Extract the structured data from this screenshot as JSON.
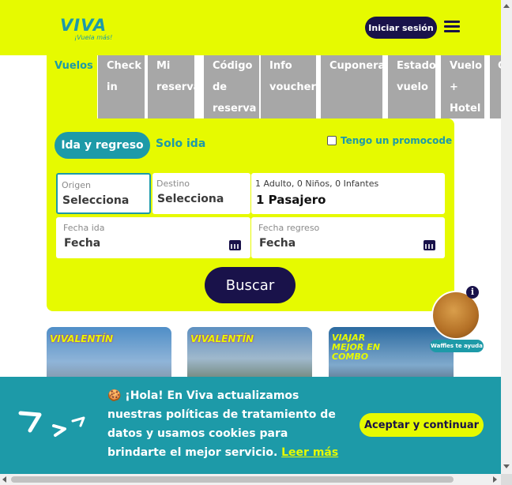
{
  "header": {
    "logo_word": "VIVA",
    "logo_tagline": "¡Vuela más!",
    "login_label": "Iniciar sesión"
  },
  "tabs": [
    {
      "label": "Vuelos",
      "active": true
    },
    {
      "label": "Check in",
      "active": false
    },
    {
      "label": "Mi reserva",
      "active": false
    },
    {
      "label": "Código de reserva",
      "active": false
    },
    {
      "label": "Info voucher",
      "active": false
    },
    {
      "label": "Cuponera",
      "active": false
    },
    {
      "label": "Estado vuelo",
      "active": false
    },
    {
      "label": "Vuelo + Hotel",
      "active": false
    },
    {
      "label": "C",
      "active": false
    }
  ],
  "booking": {
    "round_trip_label": "Ida y regreso",
    "one_way_label": "Solo ida",
    "promo_label": "Tengo un promocode",
    "origin": {
      "label": "Origen",
      "value": "Selecciona"
    },
    "destination": {
      "label": "Destino",
      "value": "Selecciona"
    },
    "passengers": {
      "label": "1 Adulto, 0 Niños, 0 Infantes",
      "value": "1 Pasajero"
    },
    "departure": {
      "label": "Fecha ida",
      "value": "Fecha"
    },
    "return": {
      "label": "Fecha regreso",
      "value": "Fecha"
    },
    "search_label": "Buscar"
  },
  "promo_cards": [
    {
      "tag": "VIVALENTÍN"
    },
    {
      "tag": "VIVALENTÍN"
    },
    {
      "tag": "VIAJAR MEJOR EN COMBO"
    }
  ],
  "assistant": {
    "info_glyph": "i",
    "help_label": "Waffles te ayuda"
  },
  "cookie_banner": {
    "text": "🍪 ¡Hola! En Viva actualizamos nuestras políticas de tratamiento de datos y usamos cookies para brindarte el mejor servicio.",
    "link_label": "Leer más",
    "accept_label": "Aceptar y continuar"
  },
  "colors": {
    "brand_yellow": "#e6fa00",
    "brand_teal": "#1d9aa8",
    "brand_navy": "#19124a",
    "tab_gray": "#a7a7a7"
  }
}
